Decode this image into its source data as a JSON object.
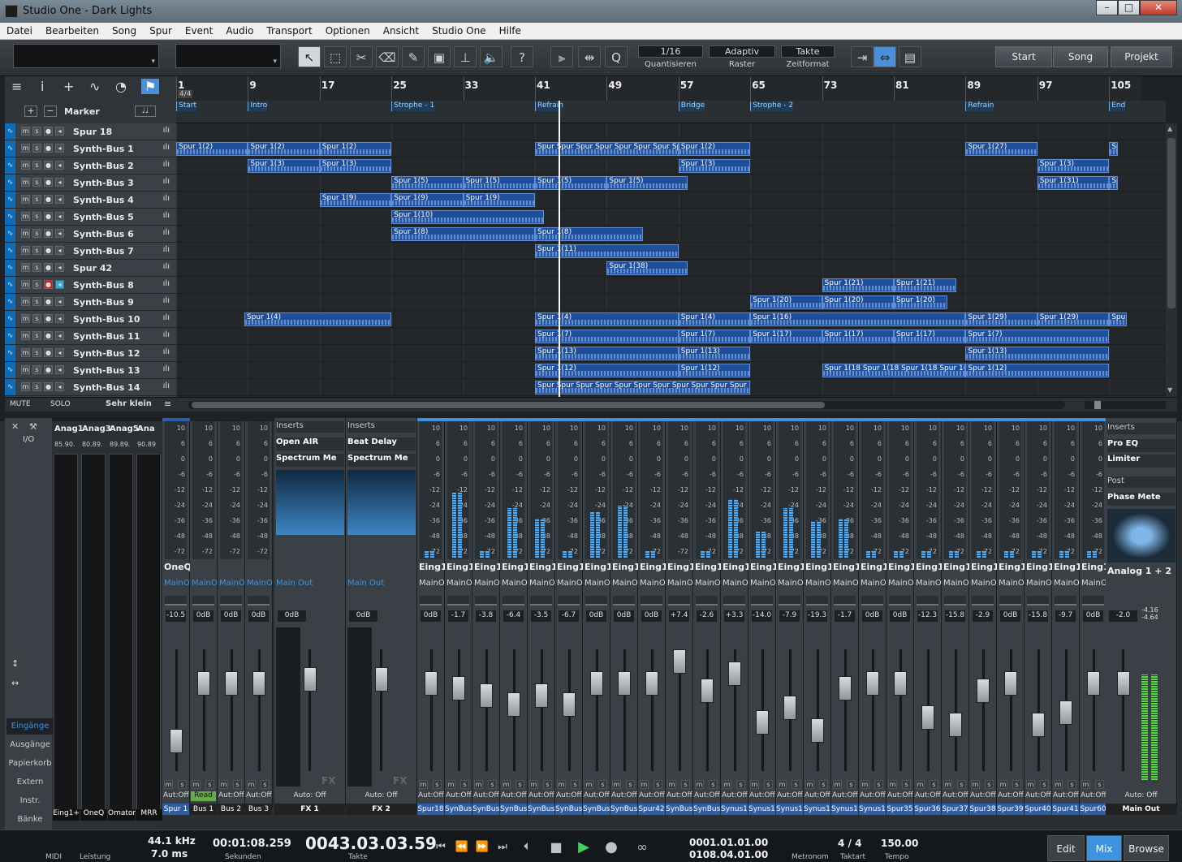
{
  "title": "Studio One - Dark Lights",
  "menu": [
    "Datei",
    "Bearbeiten",
    "Song",
    "Spur",
    "Event",
    "Audio",
    "Transport",
    "Optionen",
    "Ansicht",
    "Studio One",
    "Hilfe"
  ],
  "quantize": {
    "value": "1/16",
    "label": "Quantisieren",
    "raster_value": "Adaptiv",
    "raster_label": "Raster",
    "format_value": "Takte",
    "format_label": "Zeitformat"
  },
  "nav": {
    "start": "Start",
    "song": "Song",
    "project": "Projekt"
  },
  "ruler": [
    "1",
    "9",
    "17",
    "25",
    "33",
    "41",
    "49",
    "57",
    "65",
    "73",
    "81",
    "89",
    "97",
    "105"
  ],
  "timesig": "4/4",
  "marker_label": "Marker",
  "markers": [
    {
      "bar": 1,
      "label": "Start"
    },
    {
      "bar": 9,
      "label": "Intro"
    },
    {
      "bar": 25,
      "label": "Strophe - 1"
    },
    {
      "bar": 41,
      "label": "Refrain"
    },
    {
      "bar": 57,
      "label": "Bridge"
    },
    {
      "bar": 65,
      "label": "Strophe - 2"
    },
    {
      "bar": 89,
      "label": "Refrain"
    },
    {
      "bar": 105,
      "label": "End"
    }
  ],
  "tracks": [
    "Spur 18",
    "Synth-Bus 1",
    "Synth-Bus 2",
    "Synth-Bus 3",
    "Synth-Bus 4",
    "Synth-Bus 5",
    "Synth-Bus 6",
    "Synth-Bus 7",
    "Spur 42",
    "Synth-Bus 8",
    "Synth-Bus 9",
    "Synth-Bus 10",
    "Synth-Bus 11",
    "Synth-Bus 12",
    "Synth-Bus 13",
    "Synth-Bus 14"
  ],
  "events": [
    {
      "lane": 1,
      "start": 1,
      "end": 9,
      "label": "Spur 1(2)"
    },
    {
      "lane": 1,
      "start": 9,
      "end": 17,
      "label": "Spur 1(2)"
    },
    {
      "lane": 1,
      "start": 17,
      "end": 25,
      "label": "Spur 1(2)"
    },
    {
      "lane": 1,
      "start": 41,
      "end": 57,
      "label": "Spur Spur Spur Spur Spur Spur Spur Spur"
    },
    {
      "lane": 1,
      "start": 57,
      "end": 65,
      "label": "Spur 1(2)"
    },
    {
      "lane": 1,
      "start": 89,
      "end": 97,
      "label": "Spur 1(27)"
    },
    {
      "lane": 1,
      "start": 105,
      "end": 106,
      "label": "Spur"
    },
    {
      "lane": 2,
      "start": 9,
      "end": 17,
      "label": "Spur 1(3)"
    },
    {
      "lane": 2,
      "start": 17,
      "end": 25,
      "label": "Spur 1(3)"
    },
    {
      "lane": 2,
      "start": 57,
      "end": 65,
      "label": "Spur 1(3)"
    },
    {
      "lane": 2,
      "start": 97,
      "end": 105,
      "label": "Spur 1(3)"
    },
    {
      "lane": 3,
      "start": 25,
      "end": 33,
      "label": "Spur 1(5)"
    },
    {
      "lane": 3,
      "start": 33,
      "end": 41,
      "label": "Spur 1(5)"
    },
    {
      "lane": 3,
      "start": 41,
      "end": 49,
      "label": "Spur 1(5)"
    },
    {
      "lane": 3,
      "start": 49,
      "end": 58,
      "label": "Spur 1(5)"
    },
    {
      "lane": 3,
      "start": 97,
      "end": 105,
      "label": "Spur 1(31)"
    },
    {
      "lane": 3,
      "start": 105,
      "end": 106,
      "label": "Sp"
    },
    {
      "lane": 4,
      "start": 17,
      "end": 25,
      "label": "Spur 1(9)"
    },
    {
      "lane": 4,
      "start": 25,
      "end": 33,
      "label": "Spur 1(9)"
    },
    {
      "lane": 4,
      "start": 33,
      "end": 41,
      "label": "Spur 1(9)"
    },
    {
      "lane": 5,
      "start": 25,
      "end": 42,
      "label": "Spur 1(10)"
    },
    {
      "lane": 6,
      "start": 25,
      "end": 41,
      "label": "Spur 1(8)"
    },
    {
      "lane": 6,
      "start": 41,
      "end": 53,
      "label": "Spur 1(8)"
    },
    {
      "lane": 7,
      "start": 41,
      "end": 57,
      "label": "Spur 1(11)"
    },
    {
      "lane": 8,
      "start": 49,
      "end": 58,
      "label": "Spur 1(38)"
    },
    {
      "lane": 9,
      "start": 73,
      "end": 81,
      "label": "Spur 1(21)"
    },
    {
      "lane": 9,
      "start": 81,
      "end": 88,
      "label": "Spur 1(21)"
    },
    {
      "lane": 10,
      "start": 65,
      "end": 73,
      "label": "Spur 1(20)"
    },
    {
      "lane": 10,
      "start": 73,
      "end": 81,
      "label": "Spur 1(20)"
    },
    {
      "lane": 10,
      "start": 81,
      "end": 87,
      "label": "Spur 1(20)"
    },
    {
      "lane": 11,
      "start": 8.6,
      "end": 25,
      "label": "Spur 1(4)"
    },
    {
      "lane": 11,
      "start": 41,
      "end": 57,
      "label": "Spur 1(4)"
    },
    {
      "lane": 11,
      "start": 57,
      "end": 65,
      "label": "Spur 1(4)"
    },
    {
      "lane": 11,
      "start": 65,
      "end": 89,
      "label": "Spur 1(16)"
    },
    {
      "lane": 11,
      "start": 89,
      "end": 97,
      "label": "Spur 1(29)"
    },
    {
      "lane": 11,
      "start": 97,
      "end": 105,
      "label": "Spur 1(29)"
    },
    {
      "lane": 11,
      "start": 105,
      "end": 107,
      "label": "Spur"
    },
    {
      "lane": 12,
      "start": 41,
      "end": 57,
      "label": "Spur 1(7)"
    },
    {
      "lane": 12,
      "start": 57,
      "end": 65,
      "label": "Spur 1(7)"
    },
    {
      "lane": 12,
      "start": 65,
      "end": 73,
      "label": "Spur 1(17)"
    },
    {
      "lane": 12,
      "start": 73,
      "end": 81,
      "label": "Spur 1(17)"
    },
    {
      "lane": 12,
      "start": 81,
      "end": 89,
      "label": "Spur 1(17)"
    },
    {
      "lane": 12,
      "start": 89,
      "end": 105,
      "label": "Spur 1(7)"
    },
    {
      "lane": 13,
      "start": 41,
      "end": 57,
      "label": "Spur 1(13)"
    },
    {
      "lane": 13,
      "start": 57,
      "end": 65,
      "label": "Spur 1(13)"
    },
    {
      "lane": 13,
      "start": 89,
      "end": 105,
      "label": "Spur 1(13)"
    },
    {
      "lane": 14,
      "start": 41,
      "end": 57,
      "label": "Spur 1(12)"
    },
    {
      "lane": 14,
      "start": 57,
      "end": 65,
      "label": "Spur 1(12)"
    },
    {
      "lane": 14,
      "start": 73,
      "end": 89,
      "label": "Spur 1(18 Spur 1(18 Spur 1(18 Spur 1("
    },
    {
      "lane": 14,
      "start": 89,
      "end": 105,
      "label": "Spur 1(12)"
    },
    {
      "lane": 15,
      "start": 41,
      "end": 65,
      "label": "Spur Spur Spur Spur Spur Spur Spur Spur Spur Spur Spur"
    }
  ],
  "arrange_footer": {
    "mute": "MUTE",
    "solo": "SOLO",
    "size": "Sehr klein"
  },
  "mixer_nav": {
    "io": "I/O",
    "items": [
      "Eingänge",
      "Ausgänge",
      "Papierkorb",
      "Extern",
      "Instr.",
      "Bänke"
    ]
  },
  "instruments": [
    "Anag1",
    "Anag3",
    "Anag5",
    "Ana"
  ],
  "inst_sub": [
    "85.90.",
    "80.89.",
    "89.89.",
    "90.89"
  ],
  "inst_names": [
    "Eing1+",
    "OneQ",
    "Omaton",
    "MRR"
  ],
  "channels": [
    {
      "name": "OneQ",
      "route": "MainO",
      "vol": "-10.5",
      "auto": "Aut:Off",
      "cname": "Spur 1",
      "f": 0.25,
      "m": 0,
      "bar": "#2d5fa8"
    },
    {
      "name": "",
      "route": "MainO",
      "vol": "0dB",
      "auto": "Read",
      "cname": "Bus 1",
      "f": 0.72,
      "m": 0,
      "bar": "#222"
    },
    {
      "name": "",
      "route": "MainO",
      "vol": "0dB",
      "auto": "Aut:Off",
      "cname": "Bus 2",
      "f": 0.72,
      "m": 0,
      "bar": "#222"
    },
    {
      "name": "",
      "route": "MainO",
      "vol": "0dB",
      "auto": "Aut:Off",
      "cname": "Bus 3",
      "f": 0.72,
      "m": 0,
      "bar": "#222"
    }
  ],
  "fx_channels": [
    {
      "insert": "Open AIR",
      "insert2": "Spectrum Me",
      "route": "Main Out",
      "vol": "0dB",
      "auto": "Auto: Off",
      "cname": "FX 1",
      "fx": "FX"
    },
    {
      "insert": "Beat Delay",
      "insert2": "Spectrum Me",
      "route": "Main Out",
      "vol": "0dB",
      "auto": "Auto: Off",
      "cname": "FX 2",
      "fx": "FX"
    }
  ],
  "inserts_label": "Inserts",
  "input_channels": [
    {
      "vol": "0dB",
      "cname": "Spur18",
      "f": 0.72,
      "m": 0.05
    },
    {
      "vol": "-1.7",
      "cname": "SynBus",
      "f": 0.68,
      "m": 0.5
    },
    {
      "vol": "-3.8",
      "cname": "SynBus",
      "f": 0.62,
      "m": 0.05
    },
    {
      "vol": "-6.4",
      "cname": "SynBus",
      "f": 0.55,
      "m": 0.38
    },
    {
      "vol": "-3.5",
      "cname": "SynBus",
      "f": 0.62,
      "m": 0.3
    },
    {
      "vol": "-6.7",
      "cname": "SynBus",
      "f": 0.55,
      "m": 0.05
    },
    {
      "vol": "0dB",
      "cname": "SynBus",
      "f": 0.72,
      "m": 0.35
    },
    {
      "vol": "0dB",
      "cname": "SynBus",
      "f": 0.72,
      "m": 0.4
    },
    {
      "vol": "0dB",
      "cname": "Spur42",
      "f": 0.72,
      "m": 0.05
    },
    {
      "vol": "+7.4",
      "cname": "SynBus",
      "f": 0.9,
      "m": 0
    },
    {
      "vol": "-2.6",
      "cname": "SynBus",
      "f": 0.66,
      "m": 0.05
    },
    {
      "vol": "+3.3",
      "cname": "Synus10",
      "f": 0.8,
      "m": 0.45
    },
    {
      "vol": "-14.0",
      "cname": "Synus11",
      "f": 0.4,
      "m": 0.2
    },
    {
      "vol": "-7.9",
      "cname": "Synus12",
      "f": 0.52,
      "m": 0.38
    },
    {
      "vol": "-19.3",
      "cname": "Synus13",
      "f": 0.33,
      "m": 0.28
    },
    {
      "vol": "-1.7",
      "cname": "Synus14",
      "f": 0.68,
      "m": 0.3
    },
    {
      "vol": "0dB",
      "cname": "Synus15",
      "f": 0.72,
      "m": 0.05
    },
    {
      "vol": "0dB",
      "cname": "Spur35",
      "f": 0.72,
      "m": 0.05
    },
    {
      "vol": "-12.3",
      "cname": "Spur36",
      "f": 0.44,
      "m": 0.05
    },
    {
      "vol": "-15.8",
      "cname": "Spur37",
      "f": 0.38,
      "m": 0.05
    },
    {
      "vol": "-2.9",
      "cname": "Spur38",
      "f": 0.66,
      "m": 0.05
    },
    {
      "vol": "0dB",
      "cname": "Spur39",
      "f": 0.72,
      "m": 0.05
    },
    {
      "vol": "-15.8",
      "cname": "Spur40",
      "f": 0.38,
      "m": 0.05
    },
    {
      "vol": "-9.7",
      "cname": "Spur41",
      "f": 0.48,
      "m": 0.05
    },
    {
      "vol": "0dB",
      "cname": "Spur60",
      "f": 0.72,
      "m": 0.05
    }
  ],
  "input_strip": {
    "name": "Eing1",
    "route": "MainO",
    "auto": "Aut:Off"
  },
  "meter_scale": [
    "10",
    "6",
    "0",
    "-6",
    "-12",
    "-24",
    "-36",
    "-48",
    "-72"
  ],
  "main": {
    "inserts": [
      "Pro EQ",
      "Limiter"
    ],
    "post": "Post",
    "post_insert": "Phase Mete",
    "route": "Analog 1 + 2",
    "vol": "-2.0",
    "peak": "-4.16 -4.64",
    "auto": "Auto: Off",
    "cname": "Main Out"
  },
  "transport": {
    "samplerate": "44.1 kHz",
    "latency": "7.0 ms",
    "midi": "MIDI",
    "perf": "Leistung",
    "seconds": "00:01:08.259",
    "seconds_label": "Sekunden",
    "bars": "0043.03.03.59",
    "bars_label": "Takte",
    "loop_l": "0001.01.01.00",
    "loop_r": "0108.04.01.00",
    "metronome": "Metronom",
    "timesig": "4 / 4",
    "timesig_label": "Taktart",
    "tempo": "150.00",
    "tempo_label": "Tempo"
  },
  "pages": {
    "edit": "Edit",
    "mix": "Mix",
    "browse": "Browse"
  }
}
